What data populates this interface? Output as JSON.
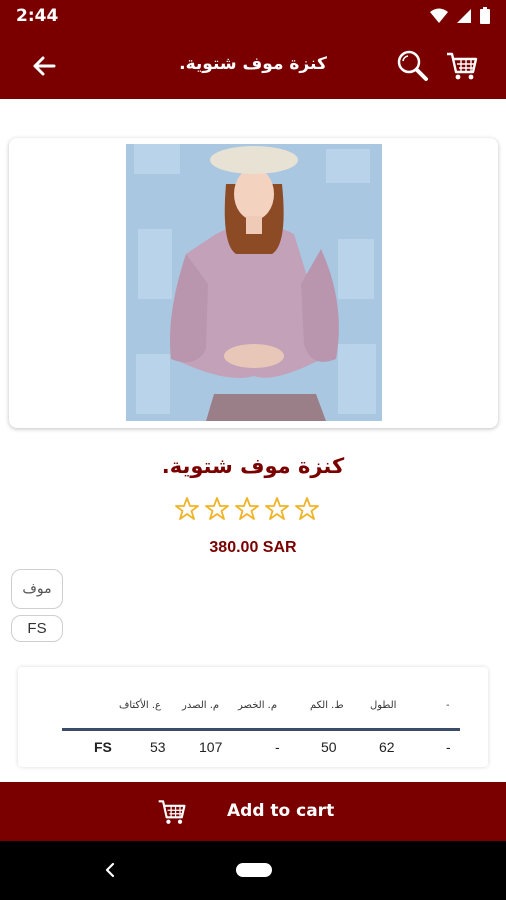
{
  "status_bar": {
    "time": "2:44"
  },
  "app_bar": {
    "title": "كنزة موف شتوية."
  },
  "product": {
    "title": "كنزة موف شتوية.",
    "rating": 0,
    "rating_max": 5,
    "price": "380.00 SAR"
  },
  "options": {
    "color": "موف",
    "size": "FS"
  },
  "size_table": {
    "headers": [
      "ع. الأكتاف",
      "م. الصدر",
      "م. الخصر",
      "ط. الكم",
      "الطول",
      "-"
    ],
    "row": [
      "FS",
      "53",
      "107",
      "-",
      "50",
      "62",
      "-"
    ]
  },
  "bottom_bar": {
    "add_to_cart_label": "Add to cart"
  },
  "colors": {
    "brand": "#7a0000",
    "star": "#f0b429",
    "table_line": "#3a4a67"
  }
}
